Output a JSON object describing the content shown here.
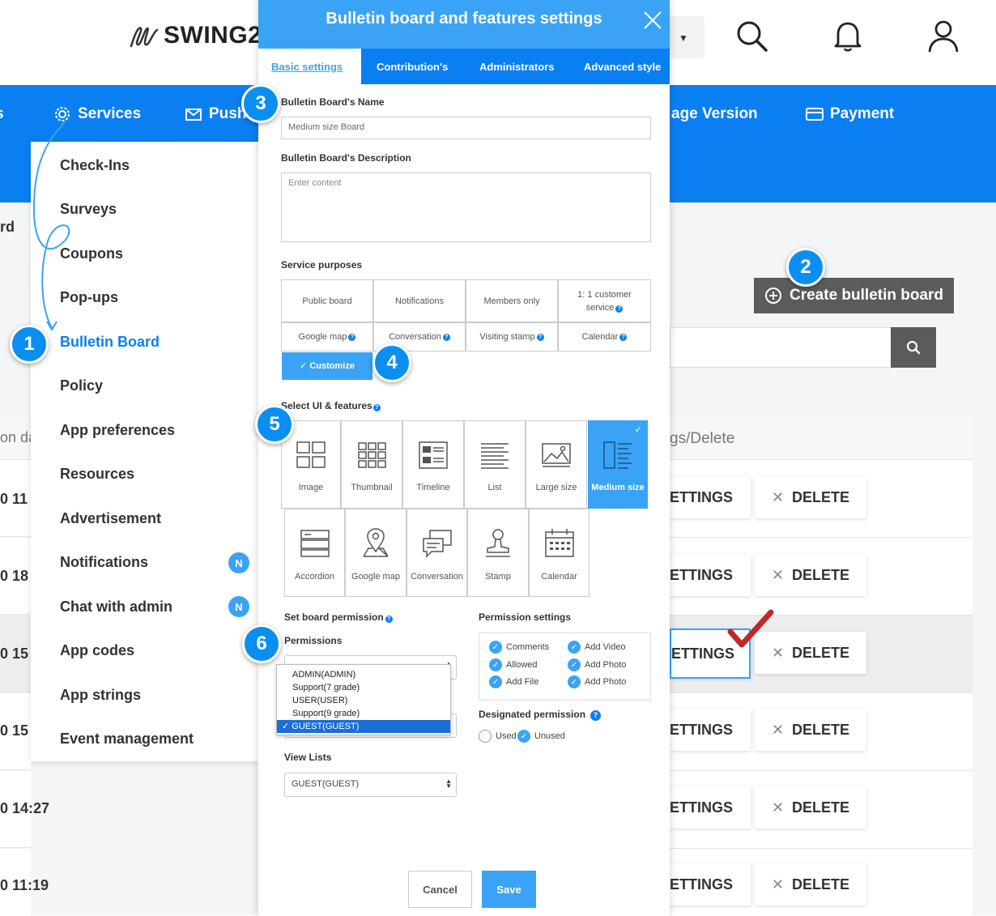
{
  "brand": {
    "logo_text": "SWING2"
  },
  "nav": {
    "services": "Services",
    "push": "Push",
    "page_version": "age Version",
    "payment": "Payment"
  },
  "menu": {
    "items": [
      {
        "label": "Check-Ins"
      },
      {
        "label": "Surveys"
      },
      {
        "label": "Coupons"
      },
      {
        "label": "Pop-ups"
      },
      {
        "label": "Bulletin Board"
      },
      {
        "label": "Policy"
      },
      {
        "label": "App preferences"
      },
      {
        "label": "Resources"
      },
      {
        "label": "Advertisement"
      },
      {
        "label": "Notifications",
        "badge": "N"
      },
      {
        "label": "Chat with admin",
        "badge": "N"
      },
      {
        "label": "App codes"
      },
      {
        "label": "App strings"
      },
      {
        "label": "Event management"
      }
    ]
  },
  "background": {
    "crumb_fragment": "rd",
    "col_fragment": "on da",
    "row_times": [
      "0 11",
      "0 18",
      "0 15",
      "0 15",
      "0 14:27",
      "0 11:19"
    ],
    "create_label": "Create bulletin board",
    "table_header": "gs/Delete",
    "settings_label": "ETTINGS",
    "delete_label": "DELETE"
  },
  "modal": {
    "title": "Bulletin board and features settings",
    "tabs": [
      "Basic settings",
      "Contribution's",
      "Administrators",
      "Advanced style"
    ],
    "name_label": "Bulletin Board's Name",
    "name_value": "Medium size Board",
    "desc_label": "Bulletin Board's Description",
    "desc_placeholder": "Enter content",
    "purposes_label": "Service purposes",
    "purposes": [
      "Public board",
      "Notifications",
      "Members only",
      "1: 1 customer service",
      "Google map",
      "Conversation",
      "Visiting stamp",
      "Calendar"
    ],
    "customize_label": "✓ Customize",
    "select_ui_label": "Select UI & features",
    "features": [
      "Image",
      "Thumbnail",
      "Timeline",
      "List",
      "Large size",
      "Medium size",
      "Accordion",
      "Google map",
      "Conversation",
      "Stamp",
      "Calendar"
    ],
    "set_permission_label": "Set board permission",
    "permissions_label": "Permissions",
    "permission_options": [
      "ADMIN(ADMIN)",
      "Support(7 grade)",
      "USER(USER)",
      "Support(9 grade)",
      "GUEST(GUEST)"
    ],
    "permission_selected": "✓ GUEST(GUEST)",
    "view_lists_label": "View Lists",
    "view_lists_value": "GUEST(GUEST)",
    "permission_settings_label": "Permission settings",
    "permission_settings": [
      "Comments",
      "Add Video",
      "Allowed",
      "Add Photo",
      "Add File",
      "Add Photo"
    ],
    "designated_label": "Designated permission",
    "designated_used": "Used",
    "designated_unused": "Unused",
    "cancel_label": "Cancel",
    "save_label": "Save"
  },
  "callouts": [
    "1",
    "2",
    "3",
    "4",
    "5",
    "6"
  ],
  "colors": {
    "primary": "#0a7ff2",
    "accent": "#3aa3f5",
    "dark_button": "#5b5b5b",
    "checkmark": "#c0282d"
  }
}
